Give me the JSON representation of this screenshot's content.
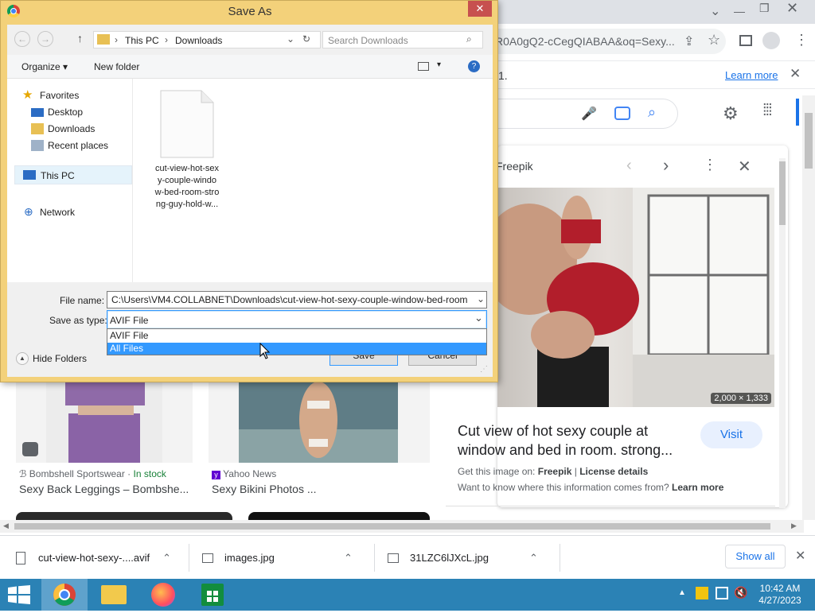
{
  "browser": {
    "url_fragment": "R0A0gQ2-cCegQIABAA&oq=Sexy...",
    "infobar_text": "1.",
    "infobar_link": "Learn more"
  },
  "preview": {
    "source_name": "Freepik",
    "image_size": "2,000 × 1,333",
    "title": "Cut view of hot sexy couple at window and bed in room. strong...",
    "visit_label": "Visit",
    "get_image_prefix": "Get this image on:",
    "get_image_source": "Freepik",
    "license_label": "License details",
    "info_question": "Want to know where this information comes from?",
    "info_link": "Learn more"
  },
  "results": [
    {
      "source": "Bombshell Sportswear",
      "stock": "In stock",
      "title": "Sexy Back Leggings – Bombshe..."
    },
    {
      "source": "Yahoo News",
      "stock": "",
      "title": "Sexy Bikini Photos ..."
    }
  ],
  "downloads": {
    "items": [
      {
        "name": "cut-view-hot-sexy-....avif"
      },
      {
        "name": "images.jpg"
      },
      {
        "name": "31LZC6lJXcL.jpg"
      }
    ],
    "show_all": "Show all"
  },
  "taskbar": {
    "time": "10:42 AM",
    "date": "4/27/2023"
  },
  "dialog": {
    "title": "Save As",
    "breadcrumb": [
      "This PC",
      "Downloads"
    ],
    "search_placeholder": "Search Downloads",
    "organize_label": "Organize",
    "new_folder_label": "New folder",
    "nav": {
      "favorites": "Favorites",
      "desktop": "Desktop",
      "downloads": "Downloads",
      "recent": "Recent places",
      "this_pc": "This PC",
      "network": "Network"
    },
    "file_item": {
      "lines": [
        "cut-view-hot-sex",
        "y-couple-windo",
        "w-bed-room-stro",
        "ng-guy-hold-w..."
      ]
    },
    "file_name_label": "File name:",
    "file_name_value": "C:\\Users\\VM4.COLLABNET\\Downloads\\cut-view-hot-sexy-couple-window-bed-room",
    "save_type_label": "Save as type:",
    "save_type_value": "AVIF File",
    "save_type_options": [
      "AVIF File",
      "All Files"
    ],
    "hide_folders_label": "Hide Folders",
    "save_label": "Save",
    "cancel_label": "Cancel"
  },
  "colors": {
    "dialog_frame": "#f3d17a",
    "selection": "#3399ff",
    "taskbar": "#2b82b5",
    "google_blue": "#1a73e8"
  }
}
